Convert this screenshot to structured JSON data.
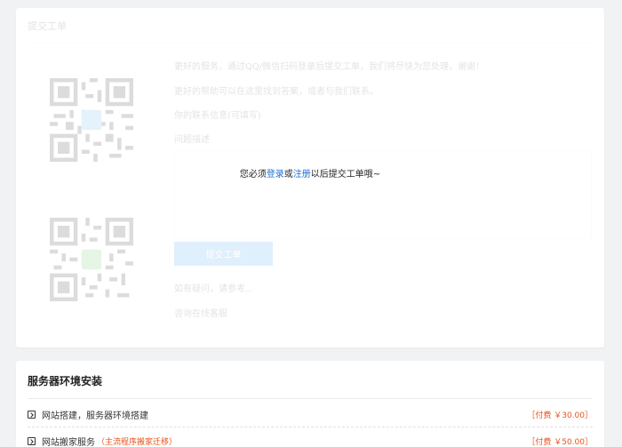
{
  "ticket": {
    "title": "提交工单",
    "line1": "更好的服务，通过QQ/微信扫码登录后提交工单，我们将尽快为您处理，谢谢！",
    "line2": "更好的帮助可以在这里找到答案，或者与我们联系。",
    "line3": "你的联系信息(可填写)",
    "field_label": "问题描述",
    "submit_label": "提交工单",
    "help_link": "如有疑问，请参考...",
    "online_link": "咨询在线客服",
    "notice_prefix": "您必须",
    "notice_login": "登录",
    "notice_or": "或",
    "notice_register": "注册",
    "notice_suffix": "以后提交工单哦~"
  },
  "env": {
    "title": "服务器环境安装",
    "rows": [
      {
        "name": "网站搭建，服务器环境搭建",
        "tag": "",
        "price": "［付费 ￥30.00］"
      },
      {
        "name": "网站搬家服务",
        "tag": "（主流程序搬家迁移）",
        "price": "［付费 ￥50.00］"
      }
    ]
  },
  "colors": {
    "accent": "#1e6fd9",
    "price": "#e8531c",
    "background": "#f1f2f4"
  },
  "icons": {
    "qr_qq": "qq-qr-code",
    "qr_wechat": "wechat-qr-code",
    "row_icon": "arrow-box-icon"
  }
}
